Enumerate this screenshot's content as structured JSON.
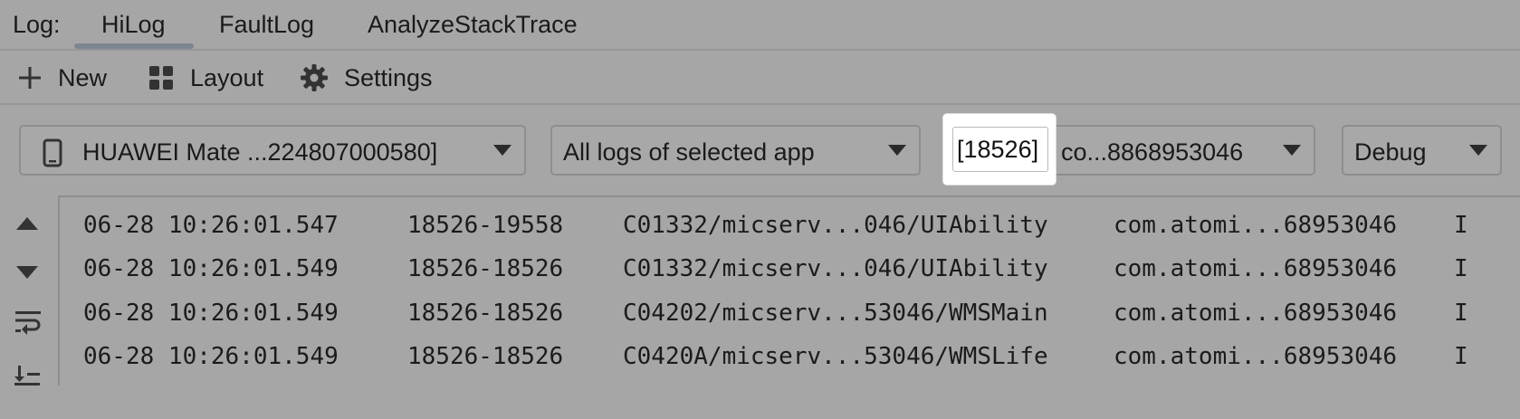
{
  "tabs": {
    "label": "Log:",
    "items": [
      "HiLog",
      "FaultLog",
      "AnalyzeStackTrace"
    ],
    "active": "HiLog"
  },
  "toolbar": {
    "new_label": "New",
    "layout_label": "Layout",
    "settings_label": "Settings"
  },
  "filters": {
    "device": "HUAWEI Mate ...224807000580]",
    "scope": "All logs of selected app",
    "process_highlight": "[18526]",
    "process_rest": "co...8868953046",
    "level": "Debug"
  },
  "log": {
    "rows": [
      {
        "time": "06-28 10:26:01.547",
        "pid": "18526-19558",
        "tag": "C01332/micserv...046/UIAbility",
        "pkg": "com.atomi...68953046",
        "level": "I"
      },
      {
        "time": "06-28 10:26:01.549",
        "pid": "18526-18526",
        "tag": "C01332/micserv...046/UIAbility",
        "pkg": "com.atomi...68953046",
        "level": "I"
      },
      {
        "time": "06-28 10:26:01.549",
        "pid": "18526-18526",
        "tag": "C04202/micserv...53046/WMSMain",
        "pkg": "com.atomi...68953046",
        "level": "I"
      },
      {
        "time": "06-28 10:26:01.549",
        "pid": "18526-18526",
        "tag": "C0420A/micserv...53046/WMSLife",
        "pkg": "com.atomi...68953046",
        "level": "I"
      }
    ]
  },
  "icons": {
    "new": "plus-icon",
    "layout": "grid-icon",
    "settings": "gear-icon",
    "device": "phone-icon",
    "scroll_up": "triangle-up-icon",
    "scroll_down": "triangle-down-icon",
    "wrap": "soft-wrap-icon",
    "scroll_end": "scroll-to-end-icon"
  },
  "colors": {
    "background": "#a6a6a6",
    "highlight": "#ffffff",
    "tab_underline": "#7d8690"
  }
}
